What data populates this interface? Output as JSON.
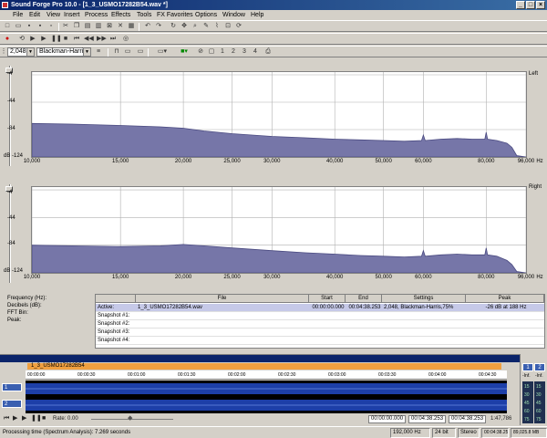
{
  "window": {
    "title": "Sound Forge Pro 10.0 - [1_3_USMO17282B54.wav *]",
    "minimize": "_",
    "maximize": "□",
    "close": "×"
  },
  "menu": [
    "File",
    "Edit",
    "View",
    "Insert",
    "Process",
    "Effects",
    "Tools",
    "FX Favorites",
    "Options",
    "Window",
    "Help"
  ],
  "spectrum_toolbar": {
    "fft_size": "2,048",
    "window_fn": "Blackman-Harris",
    "snap_numbers": [
      "1",
      "2",
      "3",
      "4"
    ]
  },
  "chart_data": [
    {
      "type": "area",
      "channel_label": "Left",
      "y_ticks": [
        "-4",
        "-44",
        "-84",
        "dB -124"
      ],
      "ylim": [
        -124,
        0
      ],
      "x_ticks": [
        "10,000",
        "15,000",
        "20,000",
        "25,000",
        "30,000",
        "40,000",
        "50,000",
        "60,000",
        "80,000",
        "96,000"
      ],
      "x_unit": "Hz",
      "x": [
        10000,
        12000,
        15000,
        18000,
        20000,
        22000,
        25000,
        30000,
        35000,
        40000,
        45000,
        50000,
        55000,
        59500,
        60000,
        60500,
        65000,
        70000,
        75000,
        79500,
        80000,
        80500,
        84000,
        88000,
        90000,
        92000,
        96000
      ],
      "values": [
        -75,
        -76,
        -78,
        -80,
        -82,
        -86,
        -90,
        -94,
        -96,
        -98,
        -99,
        -100,
        -101,
        -100,
        -92,
        -100,
        -98,
        -97,
        -98,
        -98,
        -88,
        -98,
        -100,
        -104,
        -110,
        -122,
        -124
      ]
    },
    {
      "type": "area",
      "channel_label": "Right",
      "y_ticks": [
        "-4",
        "-44",
        "-84",
        "dB -124"
      ],
      "ylim": [
        -124,
        0
      ],
      "x_ticks": [
        "10,000",
        "15,000",
        "20,000",
        "25,000",
        "30,000",
        "40,000",
        "50,000",
        "60,000",
        "80,000",
        "96,000"
      ],
      "x_unit": "Hz",
      "x": [
        10000,
        12000,
        15000,
        18000,
        20000,
        22000,
        25000,
        30000,
        35000,
        40000,
        45000,
        50000,
        55000,
        59500,
        60000,
        60500,
        65000,
        70000,
        75000,
        79500,
        80000,
        80500,
        84000,
        88000,
        90000,
        92000,
        96000
      ],
      "values": [
        -84,
        -85,
        -86,
        -85,
        -83,
        -85,
        -88,
        -92,
        -95,
        -97,
        -99,
        -100,
        -101,
        -100,
        -92,
        -100,
        -98,
        -97,
        -98,
        -98,
        -88,
        -98,
        -100,
        -106,
        -112,
        -122,
        -124
      ]
    }
  ],
  "info": {
    "labels": [
      "Frequency (Hz):",
      "Decibels (dB):",
      "FFT Bin:",
      "Peak:"
    ]
  },
  "snapshot_table": {
    "headers": [
      "",
      "File",
      "Start",
      "End",
      "Settings",
      "Peak"
    ],
    "rows": [
      [
        "Active:",
        "1_3_USMO17282B54.wav",
        "00:00:00.000",
        "00:04:38.253",
        "2,048, Blackman-Harris,75%",
        "-26 dB at 188 Hz"
      ],
      [
        "Snapshot #1:",
        "",
        "",
        "",
        "",
        ""
      ],
      [
        "Snapshot #2:",
        "",
        "",
        "",
        "",
        ""
      ],
      [
        "Snapshot #3:",
        "",
        "",
        "",
        "",
        ""
      ],
      [
        "Snapshot #4:",
        "",
        "",
        "",
        "",
        ""
      ]
    ]
  },
  "data_window": {
    "file_tab": "1_3_USMO17282B54",
    "ruler_ticks": [
      "00:00:00",
      "00:00:30",
      "00:01:00",
      "00:01:30",
      "00:02:00",
      "00:02:30",
      "00:03:00",
      "00:03:30",
      "00:04:00",
      "00:04:30"
    ],
    "channels": [
      "1",
      "2"
    ],
    "rate_label": "Rate: 0.00",
    "pos_start": "00:00:00.000",
    "pos_end": "00:04:38.253",
    "pos_length": "00:04:38.253",
    "zoom": "1:47,786"
  },
  "meter": {
    "buttons": [
      "1",
      "2"
    ],
    "labels": [
      "-Inf.",
      "-Inf."
    ],
    "scale": [
      "15",
      "30",
      "45",
      "60",
      "75"
    ]
  },
  "status": {
    "message": "Processing time (Spectrum Analysis): 7.269 seconds",
    "sample_rate": "192,000 Hz",
    "bit_depth": "24 bit",
    "channels": "Stereo",
    "length": "00:04:38.253",
    "disk": "89,025.8 MB"
  }
}
